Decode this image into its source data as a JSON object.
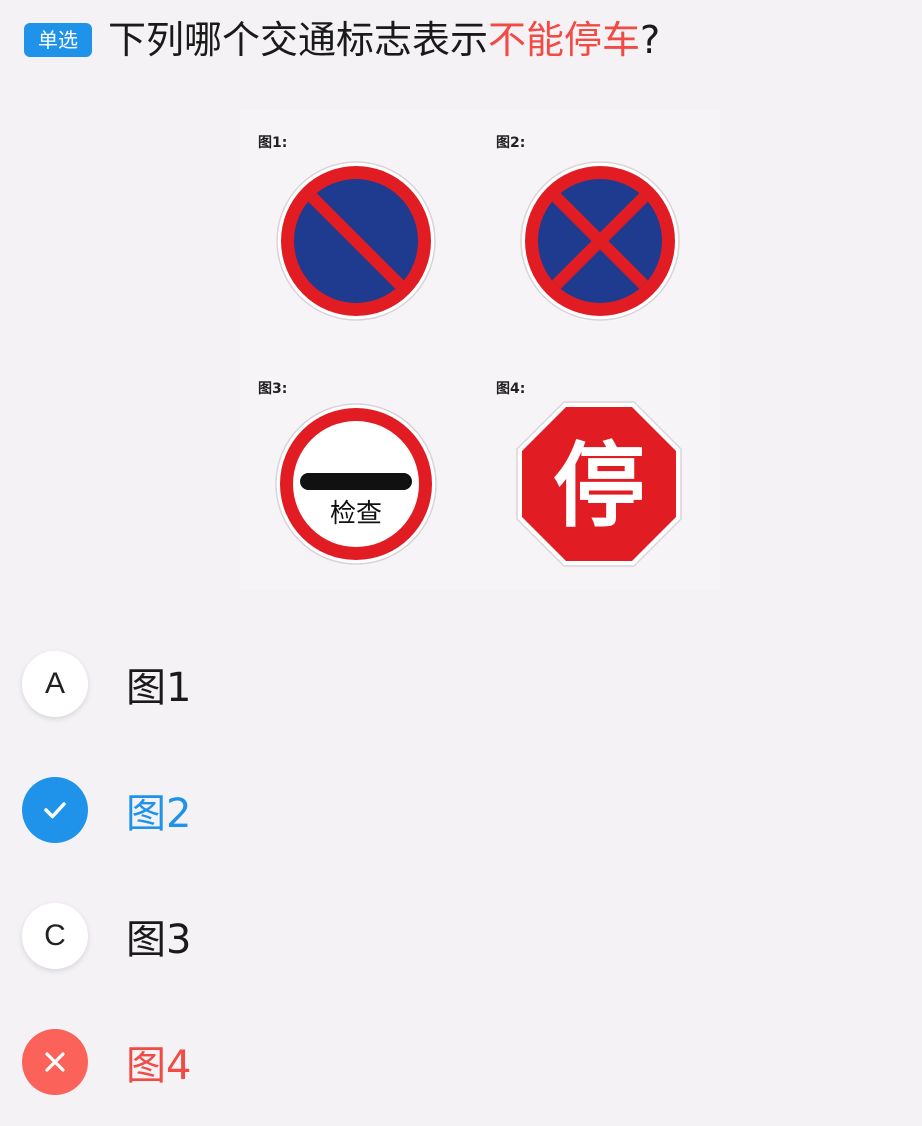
{
  "question": {
    "type_badge": "单选",
    "text_before": "下列哪个交通标志表示",
    "text_highlight": "不能停车",
    "text_after": "?"
  },
  "figures": [
    {
      "label": "图1:",
      "icon": "no-parking-sign-icon"
    },
    {
      "label": "图2:",
      "icon": "no-stopping-sign-icon"
    },
    {
      "label": "图3:",
      "icon": "inspection-stop-sign-icon",
      "sign_text": "检查"
    },
    {
      "label": "图4:",
      "icon": "stop-octagon-sign-icon",
      "sign_text": "停"
    }
  ],
  "options": [
    {
      "marker": "A",
      "label": "图1",
      "state": "normal"
    },
    {
      "marker": "",
      "label": "图2",
      "state": "correct",
      "icon": "checkmark-icon"
    },
    {
      "marker": "C",
      "label": "图3",
      "state": "normal"
    },
    {
      "marker": "",
      "label": "图4",
      "state": "wrong",
      "icon": "cross-icon"
    }
  ],
  "colors": {
    "accent_blue": "#1f93ea",
    "error_red": "#f24a44",
    "sign_red": "#e11d23",
    "sign_blue": "#1e3b8f"
  }
}
